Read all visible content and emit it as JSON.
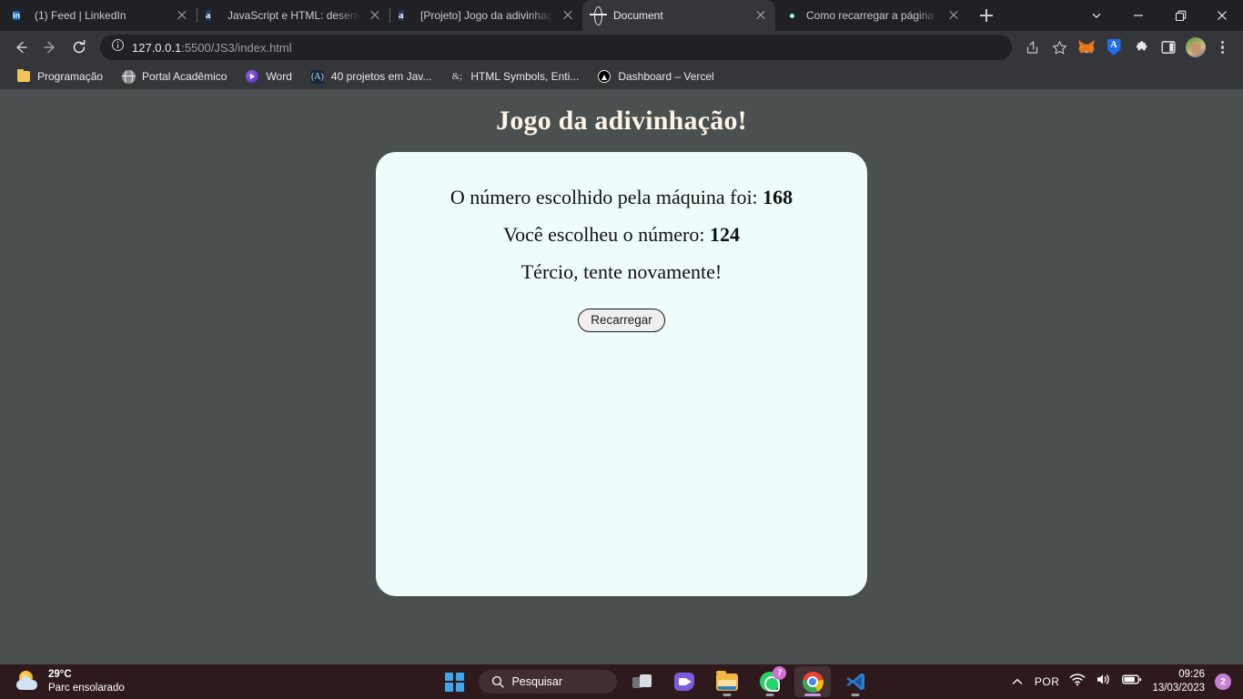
{
  "browser": {
    "tabs": [
      {
        "title": "(1) Feed | LinkedIn",
        "favicon": "linkedin-icon",
        "active": false
      },
      {
        "title": "JavaScript e HTML: desenvolv",
        "favicon": "alura-icon",
        "active": false
      },
      {
        "title": "[Projeto] Jogo da adivinhaçã",
        "favicon": "alura-icon",
        "active": false
      },
      {
        "title": "Document",
        "favicon": "globe-icon",
        "active": true
      },
      {
        "title": "Como recarregar a página co",
        "favicon": "atom-icon",
        "active": false
      }
    ],
    "new_tab_label": "+",
    "window_controls": {
      "tab_search": "tab-search-chevron",
      "minimize": "minimize",
      "maximize": "maximize",
      "close": "close"
    },
    "toolbar": {
      "back": "back-arrow",
      "forward": "forward-arrow",
      "reload": "reload-arrow",
      "site_info": "info-circle",
      "url_host": "127.0.0.1",
      "url_path": ":5500/JS3/index.html",
      "url_full": "127.0.0.1:5500/JS3/index.html",
      "share": "share-icon",
      "bookmark": "star-icon",
      "extensions": [
        {
          "name": "metamask-icon"
        },
        {
          "name": "extension-a-icon",
          "label": "A"
        },
        {
          "name": "puzzle-icon"
        },
        {
          "name": "side-panel-icon"
        }
      ],
      "profile": "avatar",
      "menu": "kebab-menu"
    },
    "bookmarks": [
      {
        "label": "Programação",
        "icon": "folder-icon"
      },
      {
        "label": "Portal Acadêmico",
        "icon": "globe-icon"
      },
      {
        "label": "Word",
        "icon": "word-icon"
      },
      {
        "label": "40 projetos em Jav...",
        "icon": "alura-icon"
      },
      {
        "label": "HTML Symbols, Enti...",
        "icon": "ampersand-icon"
      },
      {
        "label": "Dashboard – Vercel",
        "icon": "vercel-icon"
      }
    ]
  },
  "page": {
    "title": "Jogo da adivinhação!",
    "lines": [
      {
        "text": "O número escolhido pela máquina foi: ",
        "value": "168"
      },
      {
        "text": "Você escolheu o número: ",
        "value": "124"
      }
    ],
    "result_message": "Tércio, tente novamente!",
    "reload_button": "Recarregar",
    "colors": {
      "background": "#4a4f4f",
      "card": "#effcfc",
      "title": "#fdf5e6"
    }
  },
  "taskbar": {
    "weather": {
      "temperature": "29°C",
      "condition": "Parc ensolarado",
      "icon": "sun-cloud-icon"
    },
    "start": "start-icon",
    "search_placeholder": "Pesquisar",
    "apps": [
      {
        "name": "task-view",
        "badge": ""
      },
      {
        "name": "teams",
        "badge": ""
      },
      {
        "name": "file-explorer",
        "badge": ""
      },
      {
        "name": "whatsapp",
        "badge": "7"
      },
      {
        "name": "chrome",
        "badge": ""
      },
      {
        "name": "vscode",
        "badge": ""
      }
    ],
    "tray": {
      "chevron": "show-hidden-icons",
      "language": "POR",
      "wifi": "wifi-icon",
      "volume": "volume-icon",
      "battery": "battery-icon",
      "time": "09:26",
      "date": "13/03/2023",
      "notifications": "2"
    }
  }
}
